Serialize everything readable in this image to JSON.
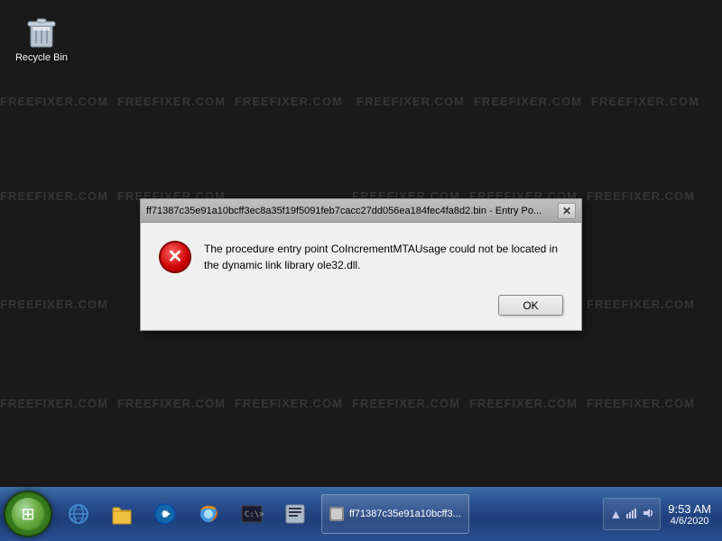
{
  "desktop": {
    "background_color": "#1a1a1a",
    "watermarks": [
      "FREEFIXER.COM",
      "FREEFIXER.COM",
      "FREEFIXER.COM",
      "FREEFIXER.COM",
      "FREEFIXER.COM",
      "FREEFIXER.COM",
      "FREEFIXER.COM",
      "FREEFIXER.COM",
      "FREEFIXER.COM",
      "FREEFIXER.COM",
      "FREEFIXER.COM",
      "FREEFIXER.COM",
      "FREEFIXER.COM",
      "FREEFIXER.COM",
      "FREEFIXER.COM",
      "FREEFIXER.COM",
      "FREEFIXER.COM",
      "FREEFIXER.COM",
      "FREEFIXER.COM",
      "FREEFIXER.COM",
      "FREEFIXER.COM"
    ]
  },
  "recycle_bin": {
    "label": "Recycle Bin",
    "icon": "🗑"
  },
  "dialog": {
    "title": "ff71387c35e91a10bcff3ec8a35f19f5091feb7cacc27dd056ea184fec4fa8d2.bin - Entry Po...",
    "message": "The procedure entry point CoIncrementMTAUsage could not be located in the dynamic link library ole32.dll.",
    "ok_label": "OK",
    "close_label": "✕"
  },
  "taskbar": {
    "icons": [
      {
        "name": "ie-icon",
        "symbol": "🌐"
      },
      {
        "name": "explorer-icon",
        "symbol": "📁"
      },
      {
        "name": "media-player-icon",
        "symbol": "▶"
      },
      {
        "name": "firefox-icon",
        "symbol": "🦊"
      },
      {
        "name": "cmd-icon",
        "symbol": "⬛"
      },
      {
        "name": "unknown-icon",
        "symbol": "📋"
      }
    ],
    "active_item_label": "ff71387c35e91a10bcff3...",
    "tray": {
      "icons": [
        "▲",
        "🔊"
      ],
      "time": "9:53 AM",
      "date": "4/6/2020"
    }
  }
}
